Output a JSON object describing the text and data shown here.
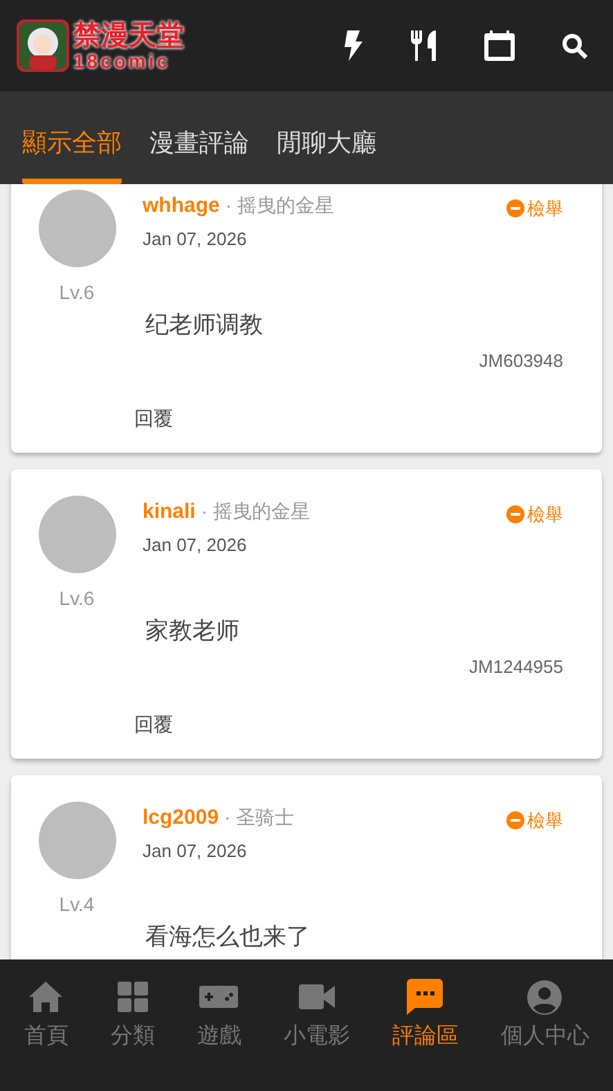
{
  "header": {
    "logo_title": "禁漫天堂",
    "logo_subtitle": "18comic"
  },
  "tabs": [
    {
      "label": "顯示全部",
      "selected": true
    },
    {
      "label": "漫畫評論",
      "selected": false
    },
    {
      "label": "閒聊大廳",
      "selected": false
    }
  ],
  "comments": [
    {
      "user": "whhage",
      "title": "· 摇曳的金星",
      "date": "Jan 07, 2026",
      "level": "Lv.6",
      "report": "檢舉",
      "text": "纪老师调教",
      "id": "JM603948",
      "reply": "回覆"
    },
    {
      "user": "kinali",
      "title": "· 摇曳的金星",
      "date": "Jan 07, 2026",
      "level": "Lv.6",
      "report": "檢舉",
      "text": "家教老师",
      "id": "JM1244955",
      "reply": "回覆"
    },
    {
      "user": "lcg2009",
      "title": "· 圣骑士",
      "date": "Jan 07, 2026",
      "level": "Lv.4",
      "report": "檢舉",
      "text": "看海怎么也来了"
    }
  ],
  "bottom_nav": [
    {
      "label": "首頁",
      "selected": false
    },
    {
      "label": "分類",
      "selected": false
    },
    {
      "label": "遊戲",
      "selected": false
    },
    {
      "label": "小電影",
      "selected": false
    },
    {
      "label": "評論區",
      "selected": true
    },
    {
      "label": "個人中心",
      "selected": false
    }
  ]
}
